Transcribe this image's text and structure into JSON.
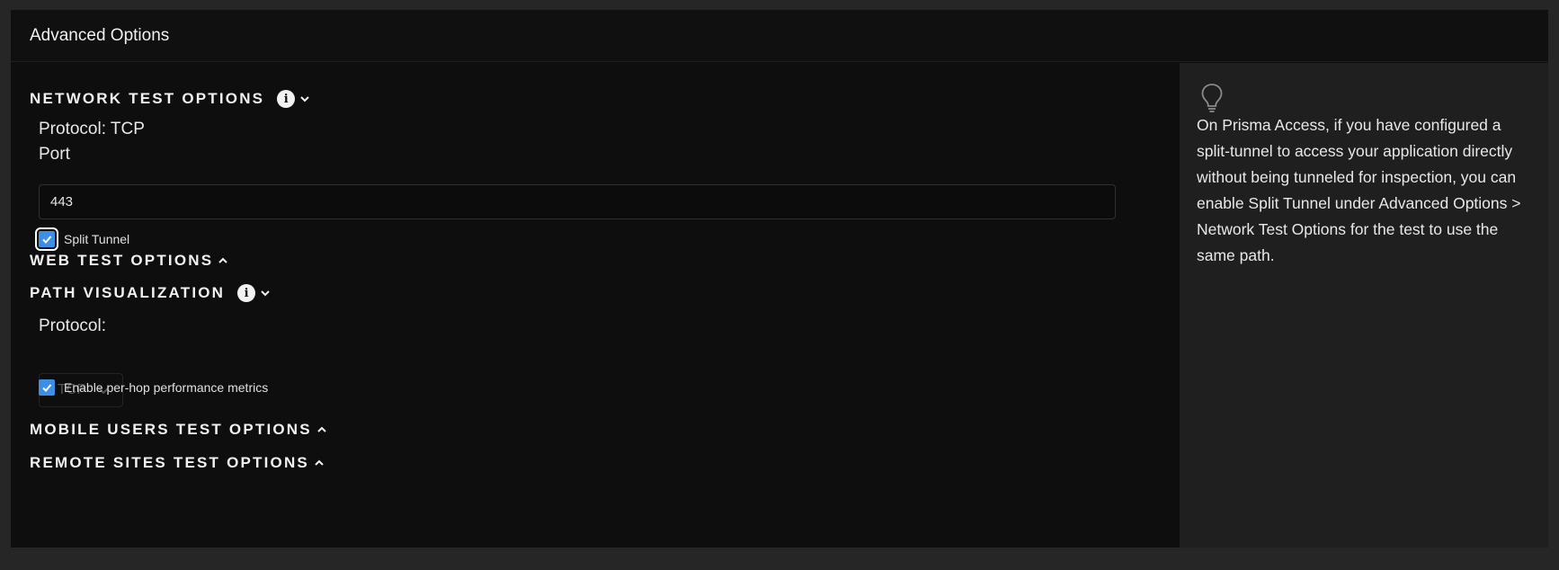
{
  "panel": {
    "title": "Advanced Options"
  },
  "network_test": {
    "heading": "NETWORK TEST OPTIONS",
    "protocol_text": "Protocol: TCP",
    "port_label": "Port",
    "port_value": "443",
    "split_tunnel_label": "Split Tunnel",
    "split_tunnel_checked": true
  },
  "web_test": {
    "heading": "WEB TEST OPTIONS"
  },
  "path_visualization": {
    "heading": "PATH VISUALIZATION",
    "protocol_label": "Protocol:",
    "protocol_selected": "TCP",
    "per_hop_label": "Enable per-hop performance metrics",
    "per_hop_checked": true
  },
  "mobile_users": {
    "heading": "MOBILE USERS TEST OPTIONS"
  },
  "remote_sites": {
    "heading": "REMOTE SITES TEST OPTIONS"
  },
  "help": {
    "icon": "lightbulb-icon",
    "text": "On Prisma Access, if you have configured a split-tunnel to access your application directly without being tunneled for inspection, you can enable Split Tunnel under Advanced Options > Network Test Options for the test to use the same path."
  },
  "colors": {
    "accent": "#3d8fe6",
    "background": "#0e0e0e",
    "sidebar": "#1f1f1f"
  }
}
